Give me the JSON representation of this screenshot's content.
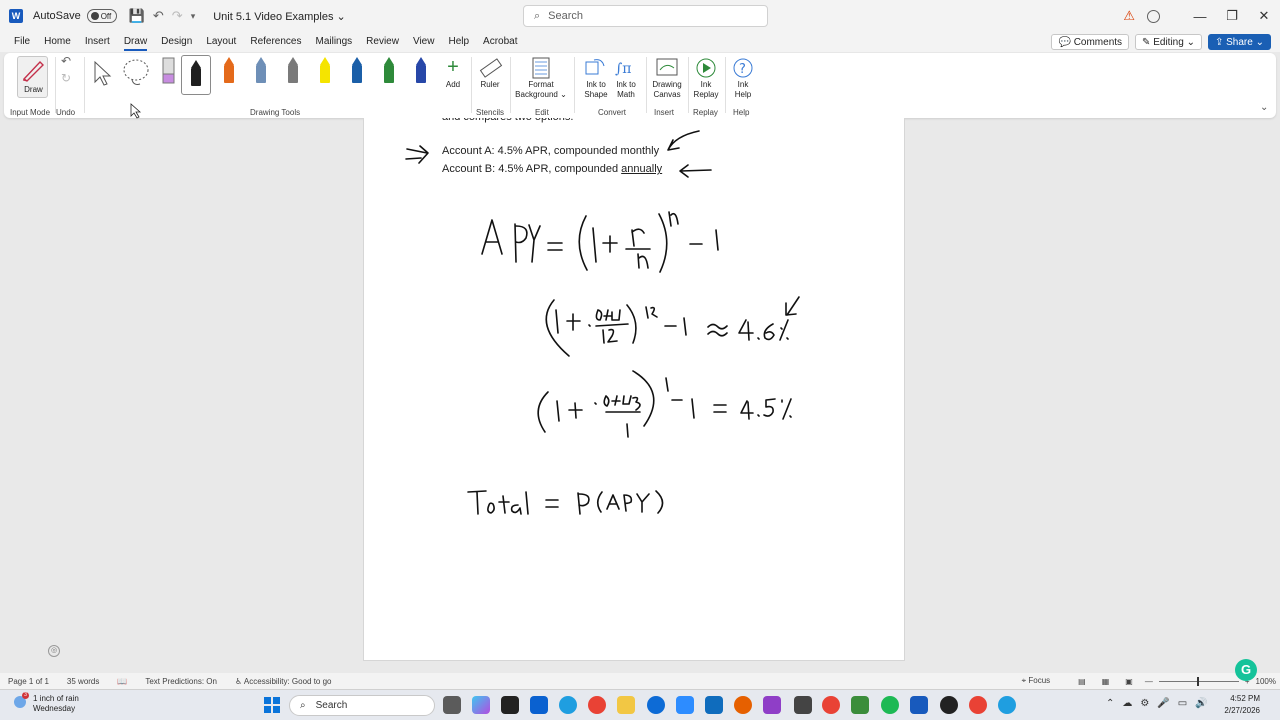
{
  "titlebar": {
    "app_logo": "W",
    "autosave_label": "AutoSave",
    "autosave_state": "Off",
    "doc_title": "Unit 5.1 Video Examples",
    "search_placeholder": "Search"
  },
  "tabs": [
    "File",
    "Home",
    "Insert",
    "Draw",
    "Design",
    "Layout",
    "References",
    "Mailings",
    "Review",
    "View",
    "Help",
    "Acrobat"
  ],
  "active_tab": "Draw",
  "tab_actions": {
    "comments": "Comments",
    "editing": "Editing",
    "share": "Share"
  },
  "ribbon": {
    "draw_label": "Draw",
    "input_mode_label": "Input Mode",
    "undo_label": "Undo",
    "drawing_tools_label": "Drawing Tools",
    "add_label": "Add",
    "ruler_label": "Ruler",
    "stencils_label": "Stencils",
    "format_bg_label_1": "Format",
    "format_bg_label_2": "Background",
    "edit_label": "Edit",
    "ink_shape_1": "Ink to",
    "ink_shape_2": "Shape",
    "ink_math_1": "Ink to",
    "ink_math_2": "Math",
    "convert_label": "Convert",
    "drawing_canvas_1": "Drawing",
    "drawing_canvas_2": "Canvas",
    "insert_label": "Insert",
    "ink_replay_1": "Ink",
    "ink_replay_2": "Replay",
    "replay_label": "Replay",
    "ink_help_1": "Ink",
    "ink_help_2": "Help",
    "help_label": "Help",
    "pen_colors": [
      "#1f1f1f",
      "#e46a1b",
      "#6e8fb7",
      "#7a7a7a",
      "#f5e400",
      "#1b5fa8",
      "#2e8a3a",
      "#2747a8"
    ]
  },
  "document": {
    "partial_line": "and compares two options.",
    "account_a": "Account A: 4.5% APR, compounded monthly",
    "account_b_prefix": "Account B: 4.5% APR, compounded ",
    "account_b_underlined": "annually"
  },
  "statusbar": {
    "page": "Page 1 of 1",
    "words": "35 words",
    "predictions": "Text Predictions: On",
    "accessibility": "Accessibility: Good to go",
    "focus": "Focus",
    "zoom": "100%"
  },
  "taskbar": {
    "weather_line1": "1 inch of rain",
    "weather_line2": "Wednesday",
    "weather_badge": "3",
    "search_label": "Search",
    "time": "4:52 PM",
    "date": "2/27/2026"
  },
  "grammarly_label": "G"
}
